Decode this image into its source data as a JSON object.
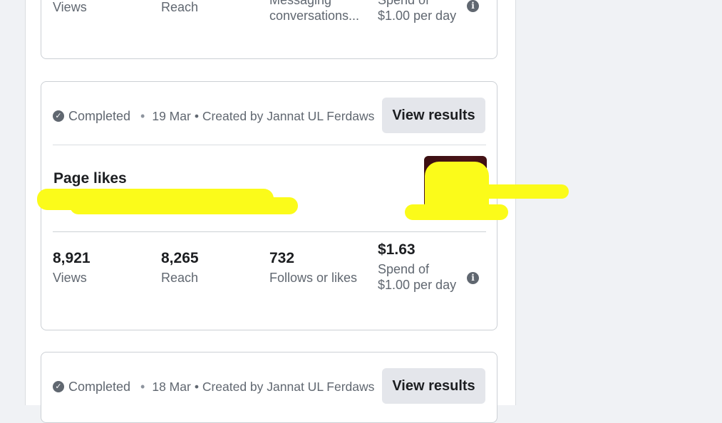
{
  "top_card": {
    "stats": [
      {
        "label": "Views"
      },
      {
        "label": "Reach"
      },
      {
        "label": "Messaging conversations..."
      },
      {
        "label": "Spend of $1.00 per day"
      }
    ]
  },
  "campaigns": [
    {
      "status": "Completed",
      "date": "19 Mar",
      "created_by": "• Created by Jannat UL Ferdaws",
      "button": "View results",
      "title": "Page likes",
      "stats": [
        {
          "value": "8,921",
          "label": "Views"
        },
        {
          "value": "8,265",
          "label": "Reach"
        },
        {
          "value": "732",
          "label": "Follows or likes"
        },
        {
          "value": "$1.63",
          "label": "Spend of $1.00 per day"
        }
      ]
    },
    {
      "status": "Completed",
      "date": "18 Mar",
      "created_by": "• Created by Jannat UL Ferdaws",
      "button": "View results"
    }
  ],
  "icons": {
    "status": "check-circle-icon",
    "info": "info-icon"
  },
  "colors": {
    "highlight": "#fbfb1a",
    "button_bg": "#e4e6eb",
    "secondary_text": "#606770"
  }
}
